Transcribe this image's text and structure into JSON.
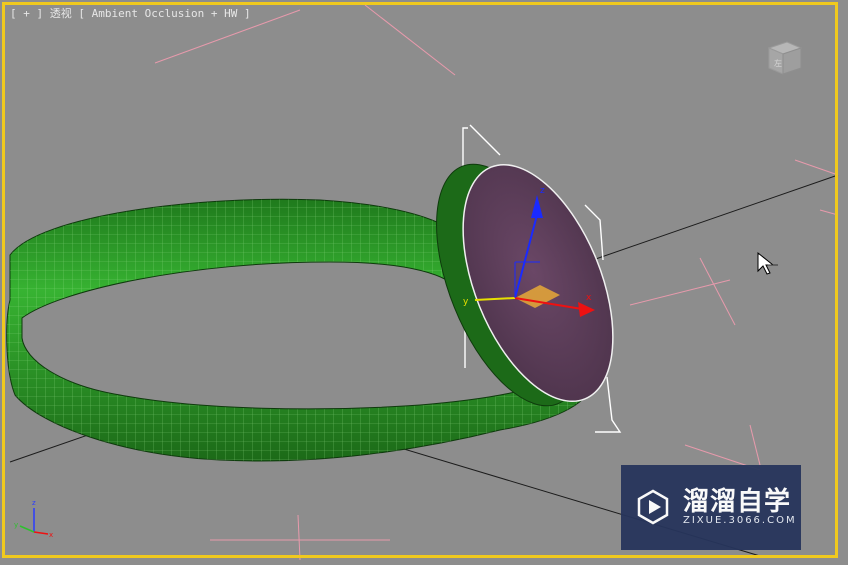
{
  "viewport": {
    "label": {
      "plus": "[ + ]",
      "view": "透视",
      "mode": "[ Ambient Occlusion + HW ]"
    },
    "viewcube_face": "左",
    "axis": {
      "x": "x",
      "y": "y",
      "z": "z"
    },
    "gizmo_axis": {
      "x": "x",
      "y": "y",
      "z": "z"
    }
  },
  "watermark": {
    "title": "溜溜自学",
    "url": "ZIXUE.3066.COM"
  },
  "colors": {
    "viewport_bg": "#8d8d8d",
    "active_border": "#f0c91e",
    "ring": "#2fa02a",
    "disc": "#5b3e58",
    "watermark_bg": "#27355c"
  }
}
